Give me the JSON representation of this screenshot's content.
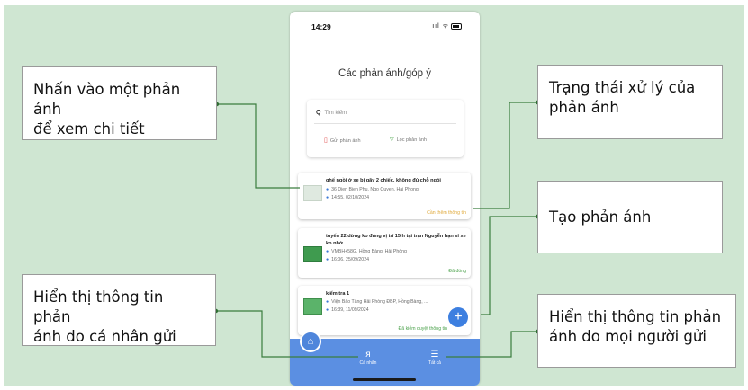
{
  "callouts": {
    "tap_card": [
      "Nhấn vào một phản ánh",
      "để xem chi tiết"
    ],
    "personal": [
      "Hiển thị thông tin phản",
      "ánh do cá nhân gửi"
    ],
    "status": [
      "Trạng thái xử lý của",
      "phản ánh"
    ],
    "create": [
      "Tạo phản ánh"
    ],
    "everyone": [
      "Hiển thị thông tin phản",
      "ánh do mọi người gửi"
    ]
  },
  "phone": {
    "time": "14:29",
    "signal": "ııl ᯤ",
    "title": "Các phản ánh/góp ý",
    "search_placeholder": "Tìm kiếm",
    "send_label": "Gửi phản ánh",
    "filter_label": "Lọc phản ánh",
    "cards": [
      {
        "title": "ghế ngồi ở xe bị gãy 2 chiếc, không đủ chỗ ngồi",
        "address": "36 Dien Bien Phu, Ngo Quyen, Hai Phong",
        "time": "14:55, 02/10/2024",
        "status": "Cần thêm thông tin",
        "status_color": "#e0a93a"
      },
      {
        "title": "tuyến 22 dừng ko đúng vị trí 15 h tại trạn Nguyễn hạn sỉ xe ko nhớ",
        "address": "VMBH+58G, Hồng Bàng, Hải Phòng",
        "time": "16:06, 25/09/2024",
        "status": "Đã đóng",
        "status_color": "#4aa14a"
      },
      {
        "title": "kiểm tra 1",
        "address": "Viện Bảo Tàng Hải Phòng ĐBP, Hồng Bàng, ...",
        "time": "16:39, 11/09/2024",
        "status": "Đã kiểm duyệt thông tin",
        "status_color": "#4aa14a"
      }
    ],
    "tabs": {
      "personal": "Cá nhân",
      "all": "Tất cả"
    }
  },
  "colors": {
    "background": "#cfe6d2",
    "accent": "#5b8fe2",
    "connector": "#3a7d3e"
  },
  "icons": [
    "search-icon",
    "document-icon",
    "filter-icon",
    "location-pin-icon",
    "clock-icon",
    "plus-icon",
    "home-icon",
    "person-icon",
    "list-icon"
  ]
}
